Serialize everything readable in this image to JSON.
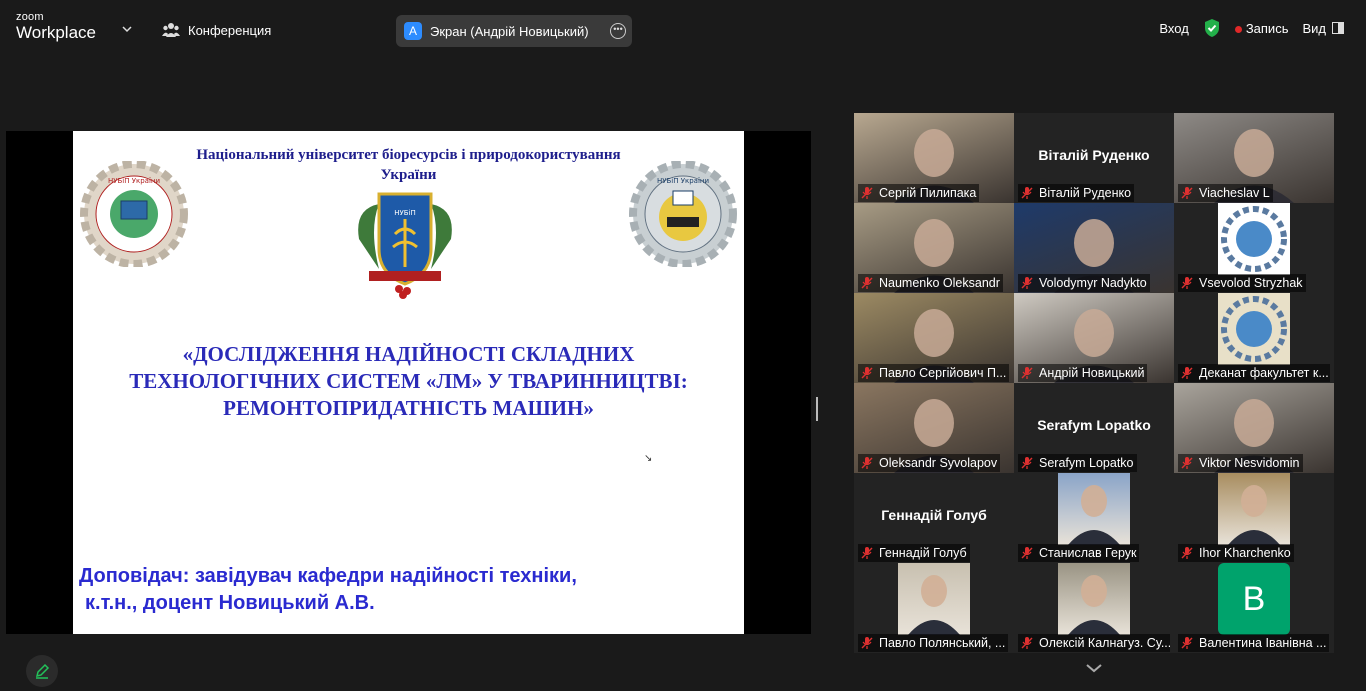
{
  "app": {
    "logo_line1": "zoom",
    "logo_line2": "Workplace"
  },
  "topbar": {
    "meeting_label": "Конференция",
    "share_badge": "A",
    "share_label": "Экран (Андрій Новицький)",
    "signin_label": "Вход",
    "record_label": "Запись",
    "view_label": "Вид"
  },
  "slide": {
    "university": "Національний університет біоресурсів і природокористування України",
    "title_lines": [
      "«ДОСЛІДЖЕННЯ НАДІЙНОСТІ СКЛАДНИХ",
      "ТЕХНОЛОГІЧНИХ СИСТЕМ «ЛМ» У ТВАРИННИЦТВІ:",
      "РЕМОНТОПРИДАТНІСТЬ МАШИН»"
    ],
    "speaker_line1": "Доповідач: завідувач кафедри надійності техніки,",
    "speaker_line2": "к.т.н., доцент Новицький А.В.",
    "left_emblem_text": "НУБіП України",
    "right_emblem_text": "НУБіП України",
    "center_emblem_text": "НУБіП"
  },
  "participants": [
    {
      "name": "Сергій Пилипака",
      "kind": "video",
      "color": "#b8a890"
    },
    {
      "name": "Віталій Руденко",
      "kind": "name",
      "display": "Віталій Руденко"
    },
    {
      "name": "Viacheslav L",
      "kind": "video",
      "color": "#8e8a86"
    },
    {
      "name": "Naumenko Oleksandr",
      "kind": "video",
      "color": "#a79b84"
    },
    {
      "name": "Volodymyr Nadykto",
      "kind": "video",
      "color": "#1e3a6a"
    },
    {
      "name": "Vsevolod Stryzhak",
      "kind": "logo",
      "color": "#ffffff"
    },
    {
      "name": "Павло Сергійович П...",
      "kind": "video",
      "color": "#9c8a63"
    },
    {
      "name": "Андрій Новицький",
      "kind": "video",
      "color": "#cfcac2",
      "active": true
    },
    {
      "name": "Деканат факультет к...",
      "kind": "logo",
      "color": "#e8e0c8"
    },
    {
      "name": "Oleksandr Syvolapov",
      "kind": "video",
      "color": "#8a7660"
    },
    {
      "name": "Serafym Lopatko",
      "kind": "name",
      "display": "Serafym Lopatko"
    },
    {
      "name": "Viktor Nesvidomin",
      "kind": "video",
      "color": "#a9a49c"
    },
    {
      "name": "Геннадій Голуб",
      "kind": "name",
      "display": "Геннадій Голуб"
    },
    {
      "name": "Станислав Герук",
      "kind": "photo",
      "color": "#8aa4c8"
    },
    {
      "name": "Ihor Kharchenko",
      "kind": "photo",
      "color": "#a88d60"
    },
    {
      "name": "Павло Полянський, ...",
      "kind": "photo",
      "color": "#c8c0b0"
    },
    {
      "name": "Олексій Калнагуз. Су...",
      "kind": "photo",
      "color": "#9a9484"
    },
    {
      "name": "Валентина Іванівна ...",
      "kind": "initial",
      "initial": "B",
      "color": "#00a36c"
    }
  ],
  "icons": {
    "muted": "mic-muted-icon",
    "participants": "people-icon",
    "security": "shield-check-icon",
    "view": "grid-view-icon"
  },
  "colors": {
    "accent": "#2d8cff",
    "record": "#e02828",
    "active_speaker": "#23d160",
    "slide_title": "#2a2ab8"
  }
}
